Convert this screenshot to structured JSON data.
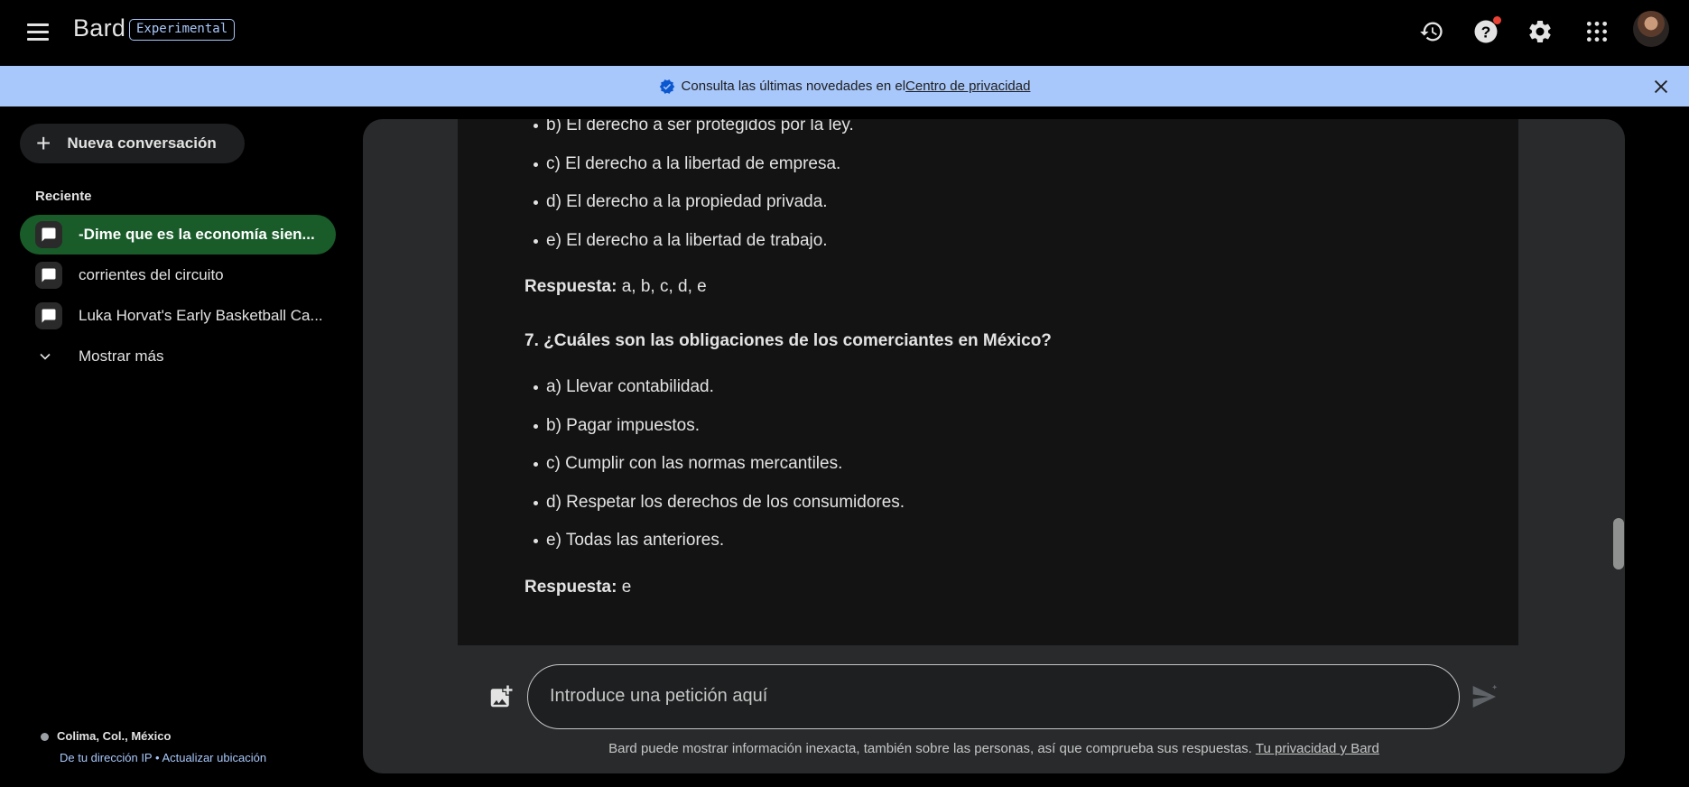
{
  "header": {
    "brand": "Bard",
    "badge": "Experimental"
  },
  "banner": {
    "text": "Consulta las últimas novedades en el ",
    "link": "Centro de privacidad"
  },
  "sidebar": {
    "new_chat": "Nueva conversación",
    "recent_title": "Reciente",
    "conversations": [
      {
        "label": "-Dime que es la economía sien...",
        "active": true
      },
      {
        "label": "corrientes del circuito",
        "active": false
      },
      {
        "label": "Luka Horvat's Early Basketball Ca...",
        "active": false
      }
    ],
    "show_more": "Mostrar más",
    "location": {
      "place": "Colima, Col., México",
      "ip_link": "De tu dirección IP",
      "separator": " • ",
      "update_link": "Actualizar ubicación"
    }
  },
  "response": {
    "items_a": [
      "b) El derecho a ser protegidos por la ley.",
      "c) El derecho a la libertad de empresa.",
      "d) El derecho a la propiedad privada.",
      "e) El derecho a la libertad de trabajo."
    ],
    "answer_a_label": "Respuesta:",
    "answer_a_value": " a, b, c, d, e",
    "question_7": "7. ¿Cuáles son las obligaciones de los comerciantes en México?",
    "items_b": [
      "a) Llevar contabilidad.",
      "b) Pagar impuestos.",
      "c) Cumplir con las normas mercantiles.",
      "d) Respetar los derechos de los consumidores.",
      "e) Todas las anteriores."
    ],
    "answer_b_label": "Respuesta:",
    "answer_b_value": " e"
  },
  "input": {
    "placeholder": "Introduce una petición aquí"
  },
  "footer": {
    "disclaimer": "Bard puede mostrar información inexacta, también sobre las personas, así que comprueba sus respuestas. ",
    "link": "Tu privacidad y Bard"
  },
  "icons": [
    "menu-icon",
    "history-icon",
    "help-icon",
    "settings-icon",
    "apps-icon",
    "verified-icon",
    "close-icon",
    "plus-icon",
    "chat-icon",
    "chevron-down-icon",
    "add-image-icon",
    "send-icon"
  ],
  "colors": {
    "banner": "#a8c7fa",
    "active_conversation": "#195c2a",
    "panel": "#282a2c",
    "response_bg": "#131314",
    "notification_dot": "#ea4335"
  }
}
